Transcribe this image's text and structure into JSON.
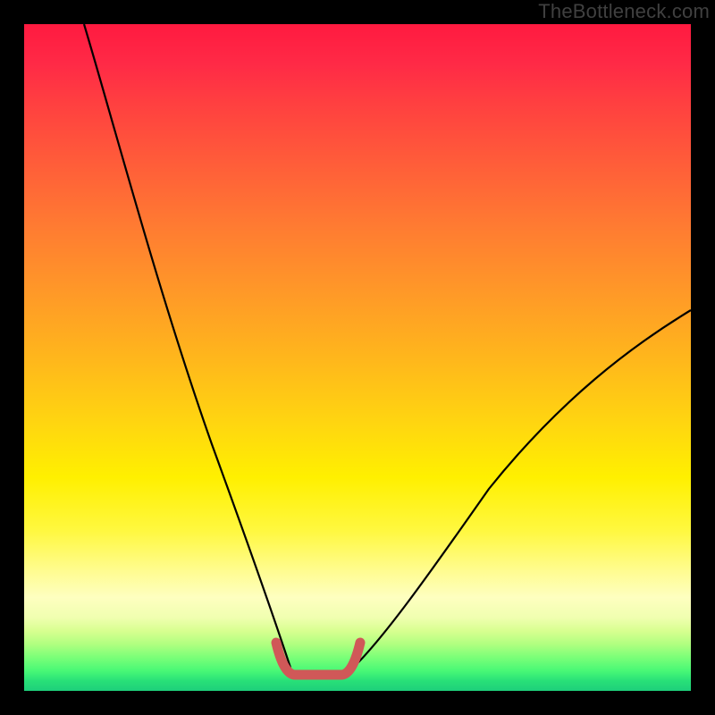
{
  "watermark": "TheBottleneck.com",
  "chart_data": {
    "type": "line",
    "title": "",
    "xlabel": "",
    "ylabel": "",
    "xlim": [
      0,
      100
    ],
    "ylim": [
      0,
      100
    ],
    "grid": false,
    "series": [
      {
        "name": "left-curve",
        "color": "#000000",
        "x": [
          9,
          14,
          19,
          24,
          29,
          34,
          37,
          40
        ],
        "values": [
          100,
          78,
          56,
          36,
          20,
          8,
          3,
          1
        ]
      },
      {
        "name": "right-curve",
        "color": "#000000",
        "x": [
          49,
          54,
          60,
          68,
          76,
          84,
          92,
          100
        ],
        "values": [
          1,
          4,
          9,
          17,
          26,
          36,
          46,
          56
        ]
      },
      {
        "name": "bottom-bracket",
        "color": "#d05858",
        "x": [
          38,
          40,
          48,
          50
        ],
        "values": [
          5,
          1,
          1,
          5
        ]
      }
    ]
  }
}
